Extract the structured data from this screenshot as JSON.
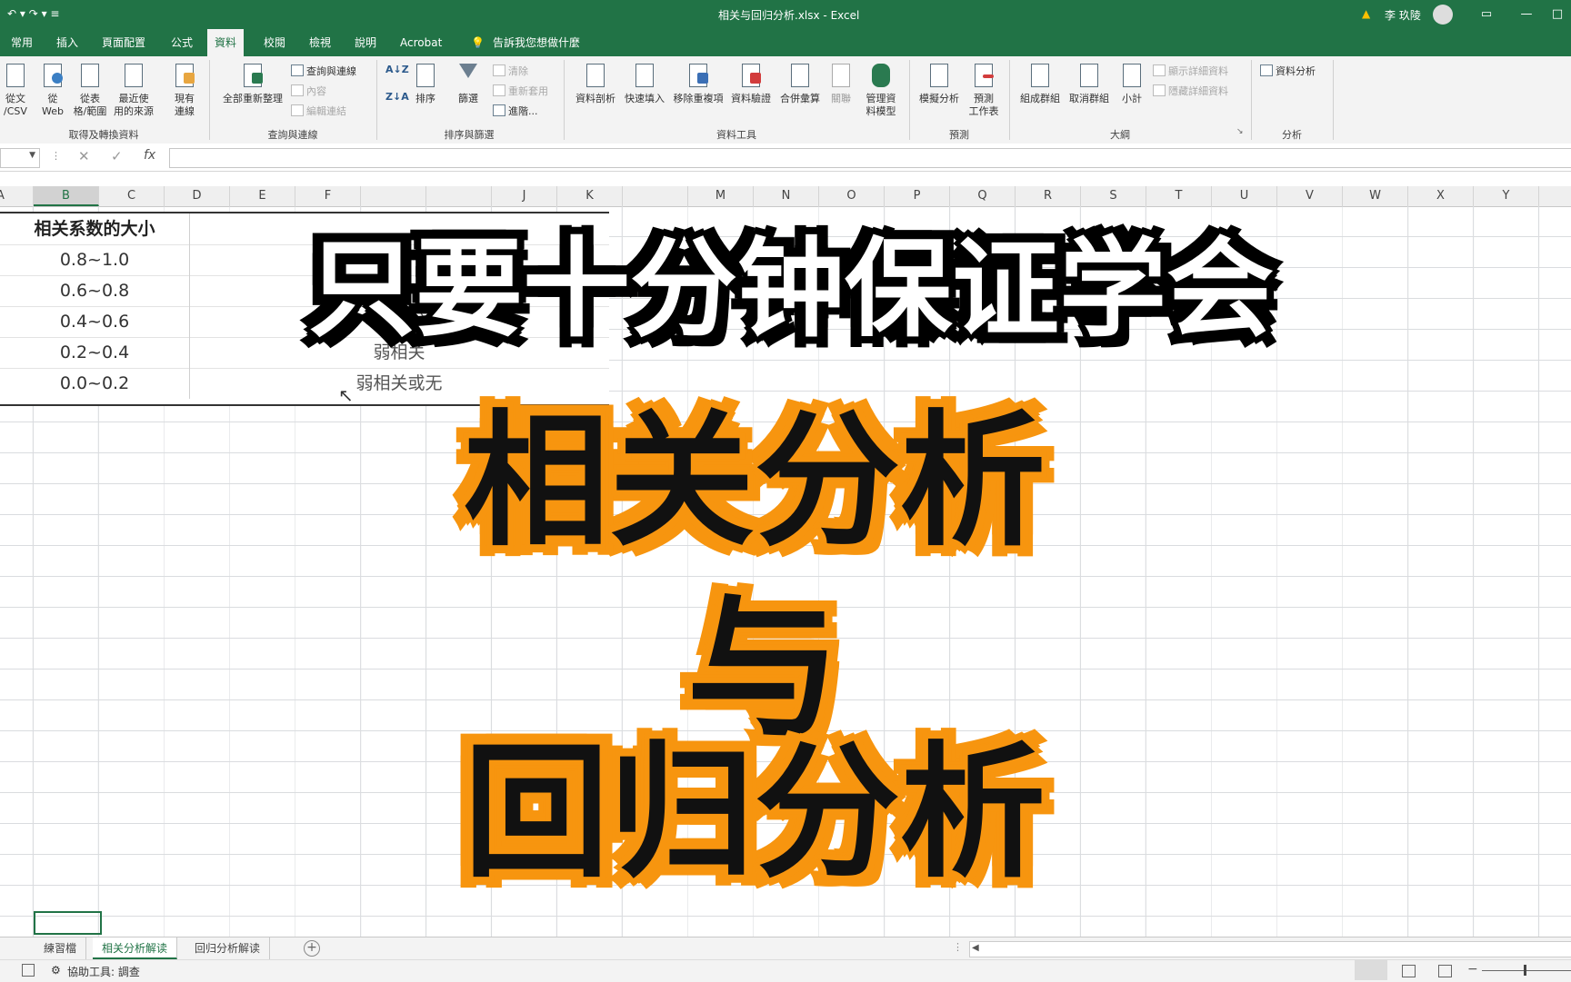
{
  "window": {
    "title": "相关与回归分析.xlsx - Excel",
    "user": "李 玖陵"
  },
  "tabs": [
    {
      "label": "常用"
    },
    {
      "label": "插入"
    },
    {
      "label": "頁面配置"
    },
    {
      "label": "公式"
    },
    {
      "label": "資料"
    },
    {
      "label": "校閱"
    },
    {
      "label": "檢視"
    },
    {
      "label": "說明"
    },
    {
      "label": "Acrobat"
    }
  ],
  "tell_me": "告訴我您想做什麼",
  "ribbon": {
    "get_data": {
      "from_csv": "從文\n/CSV",
      "from_web": "從\nWeb",
      "from_table": "從表\n格/範圍",
      "recent": "最近使\n用的來源",
      "existing": "現有\n連線",
      "label": "取得及轉換資料"
    },
    "queries": {
      "refresh_all": "全部重新整理",
      "queries_conn": "查詢與連線",
      "properties": "內容",
      "edit_links": "編輯連結",
      "label": "查詢與連線"
    },
    "sort_filter": {
      "sort": "排序",
      "filter": "篩選",
      "clear": "清除",
      "reapply": "重新套用",
      "advanced": "進階...",
      "label": "排序與篩選"
    },
    "data_tools": {
      "text_to_cols": "資料剖析",
      "flash_fill": "快速填入",
      "remove_dups": "移除重複項",
      "validation": "資料驗證",
      "consolidate": "合併彙算",
      "relationships": "關聯",
      "data_model": "管理資\n料模型",
      "label": "資料工具"
    },
    "forecast": {
      "what_if": "模擬分析",
      "forecast_sheet": "預測\n工作表",
      "label": "預測"
    },
    "outline": {
      "group": "組成群組",
      "ungroup": "取消群組",
      "subtotal": "小計",
      "show_detail": "顯示詳細資料",
      "hide_detail": "隱藏詳細資料",
      "label": "大綱"
    },
    "analysis": {
      "data_analysis": "資料分析",
      "label": "分析"
    }
  },
  "formula_bar": {
    "fx": "fx"
  },
  "columns": [
    "A",
    "B",
    "C",
    "D",
    "E",
    "F",
    "",
    "",
    "J",
    "K",
    "",
    "M",
    "N",
    "O",
    "P",
    "Q",
    "R",
    "S",
    "T",
    "U",
    "V",
    "W",
    "X",
    "Y"
  ],
  "table": {
    "header": "相关系数的大小",
    "rows": [
      {
        "range": "0.8~1.0",
        "label": ""
      },
      {
        "range": "0.6~0.8",
        "label": ""
      },
      {
        "range": "0.4~0.6",
        "label": "中度相关"
      },
      {
        "range": "0.2~0.4",
        "label": "弱相关"
      },
      {
        "range": "0.0~0.2",
        "label": "弱相关或无"
      }
    ]
  },
  "overlay": {
    "line1": "只要十分钟保证学会",
    "line2": "相关分析",
    "line3": "与",
    "line4": "回归分析"
  },
  "sheets": [
    {
      "label": "練習檔"
    },
    {
      "label": "相关分析解读"
    },
    {
      "label": "回归分析解读"
    }
  ],
  "status": {
    "accessibility": "協助工具: 調查"
  },
  "colors": {
    "excel_green": "#217346",
    "overlay_orange": "#f7950f"
  }
}
